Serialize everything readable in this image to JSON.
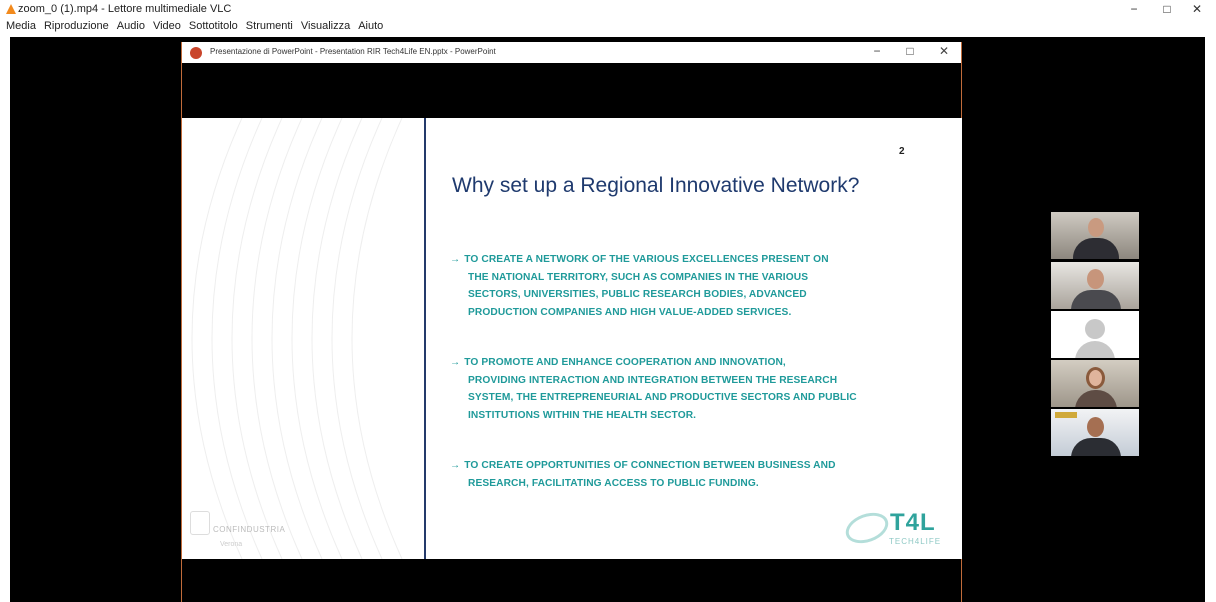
{
  "vlc": {
    "title": "zoom_0 (1).mp4 - Lettore multimediale VLC",
    "controls": {
      "minimize": "−",
      "maximize": "□",
      "close": "✕"
    },
    "menu": [
      "Media",
      "Riproduzione",
      "Audio",
      "Video",
      "Sottotitolo",
      "Strumenti",
      "Visualizza",
      "Aiuto"
    ]
  },
  "powerpoint": {
    "title": "Presentazione di PowerPoint  -  Presentation RIR Tech4Life EN.pptx - PowerPoint",
    "controls": {
      "minimize": "−",
      "maximize": "□",
      "close": "✕"
    }
  },
  "slide": {
    "number": "2",
    "title": "Why set up a Regional Innovative Network?",
    "bullets": [
      {
        "lines": [
          "TO CREATE A NETWORK OF THE VARIOUS EXCELLENCES PRESENT ON",
          "THE NATIONAL TERRITORY, SUCH AS COMPANIES IN THE VARIOUS",
          "SECTORS, UNIVERSITIES, PUBLIC RESEARCH BODIES, ADVANCED",
          "PRODUCTION COMPANIES AND HIGH VALUE-ADDED SERVICES."
        ]
      },
      {
        "lines": [
          "TO PROMOTE AND ENHANCE COOPERATION AND INNOVATION,",
          "PROVIDING INTERACTION AND INTEGRATION BETWEEN THE RESEARCH",
          "SYSTEM, THE ENTREPRENEURIAL AND PRODUCTIVE SECTORS AND PUBLIC",
          "INSTITUTIONS WITHIN THE HEALTH SECTOR."
        ]
      },
      {
        "lines": [
          "TO CREATE OPPORTUNITIES OF CONNECTION BETWEEN BUSINESS AND",
          "RESEARCH, FACILITATING ACCESS TO PUBLIC FUNDING."
        ]
      }
    ],
    "arrow": "→",
    "logo_left": {
      "name": "CONFINDUSTRIA",
      "city": "Verona"
    },
    "logo_right": {
      "name": "T4L",
      "sub": "TECH4LIFE"
    }
  },
  "participants": [
    {
      "icon": "participant-video",
      "bg": "#9a948a"
    },
    {
      "icon": "participant-video",
      "bg": "#c9c4bd"
    },
    {
      "icon": "participant-avatar",
      "bg": "#ffffff"
    },
    {
      "icon": "participant-video",
      "bg": "#b8b2a6"
    },
    {
      "icon": "participant-video",
      "bg": "#d8dde3"
    }
  ]
}
